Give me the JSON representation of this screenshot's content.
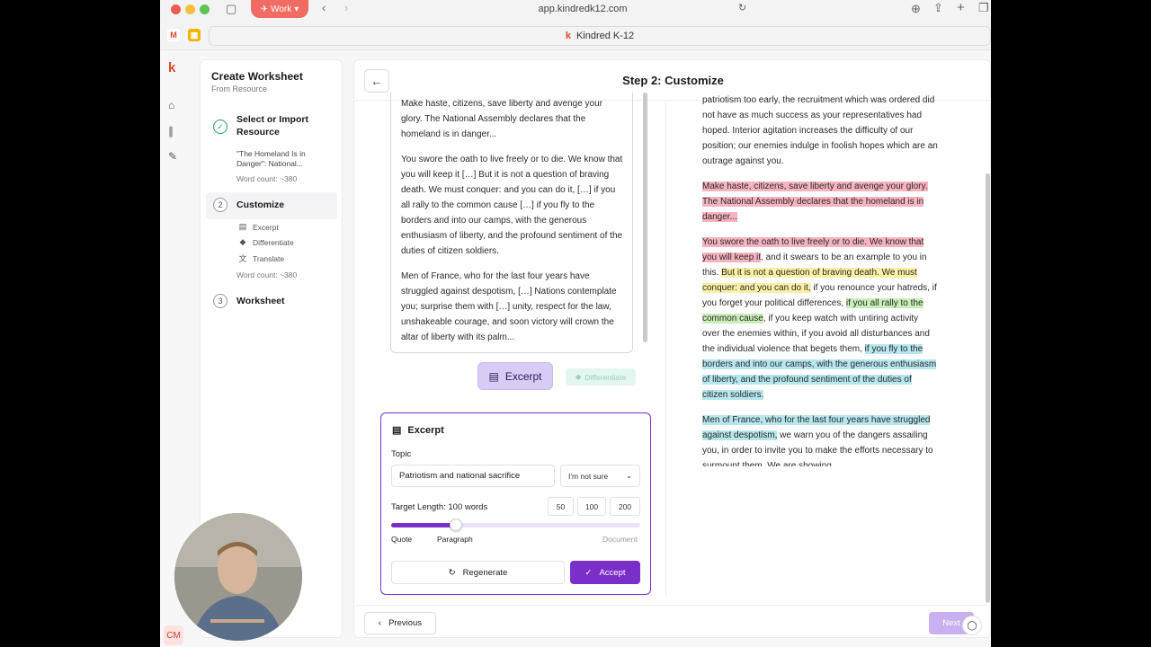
{
  "browser": {
    "profile_label": "Work",
    "url": "app.kindredk12.com",
    "tab_title": "Kindred K-12"
  },
  "sidebar": {
    "title": "Create Worksheet",
    "subtitle": "From Resource",
    "steps": [
      {
        "number": "✓",
        "label": "Select or Import Resource",
        "detail": "\"The Homeland Is in Danger\": National...",
        "word_count": "Word count: ~380"
      },
      {
        "number": "2",
        "label": "Customize",
        "sub_items": [
          "Excerpt",
          "Differentiate",
          "Translate"
        ],
        "word_count": "Word count: ~380"
      },
      {
        "number": "3",
        "label": "Worksheet"
      }
    ]
  },
  "main": {
    "title": "Step 2: Customize",
    "excerpt_paragraphs": [
      "Make haste, citizens, save liberty and avenge your glory. The National Assembly declares that the homeland is in danger...",
      "You swore the oath to live freely or to die. We know that you will keep it […] But it is not a question of braving death. We must conquer: and you can do it, […] if you all rally to the common cause […] if you fly to the borders and into our camps, with the generous enthusiasm of liberty, and the profound sentiment of the duties of citizen soldiers.",
      "Men of France, who for the last four years have struggled against despotism, […] Nations contemplate you; surprise them with […] unity, respect for the law, unshakeable courage, and soon victory will crown the altar of liberty with its palm..."
    ],
    "tools": {
      "excerpt": "Excerpt",
      "differentiate": "Differentiate"
    },
    "panel": {
      "title": "Excerpt",
      "topic_label": "Topic",
      "topic_value": "Patriotism and national sacrifice",
      "topic_select": "I'm not sure",
      "target_length_label": "Target Length: 100 words",
      "length_options": [
        "50",
        "100",
        "200"
      ],
      "slider_value": 0.26,
      "slider_marks": [
        "Quote",
        "Paragraph",
        "Document"
      ],
      "regenerate": "Regenerate",
      "accept": "Accept"
    },
    "source": {
      "intro": "patriotism too early, the recruitment which was ordered did not have as much success as your representatives had hoped. Interior agitation increases the difficulty of our position; our enemies indulge in foolish hopes which are an outrage against you.",
      "p1_red": "Make haste, citizens, save liberty and avenge your glory. The National Assembly declares that the homeland is in danger...",
      "p2_red": "You swore the oath to live freely or to die. We know that you will keep it",
      "p2_a": ", and it swears to be an example to you in this. ",
      "p2_yellow": "But it is not a question of braving death. We must conquer: and you can do it,",
      "p2_b": " if you renounce your hatreds, if you forget your political differences, ",
      "p2_green": "if you all rally to the common cause",
      "p2_c": ", if you keep watch with untiring activity over the enemies within, if you avoid all disturbances and the individual violence that begets them, ",
      "p2_blue": "if you fly to the borders and into our camps, with the generous enthusiasm of liberty, and the profound sentiment of the duties of citizen soldiers.",
      "p3_blue": "Men of France, who for the last four years have struggled against despotism,",
      "p3_a": " we warn you of the dangers assailing you, in order to invite you to make the efforts necessary to surmount them. We are showing"
    },
    "footer": {
      "previous": "Previous",
      "next": "Next"
    }
  },
  "user": {
    "initials": "CM"
  },
  "colors": {
    "accent": "#7a2fc9",
    "brand": "#e0462e"
  }
}
